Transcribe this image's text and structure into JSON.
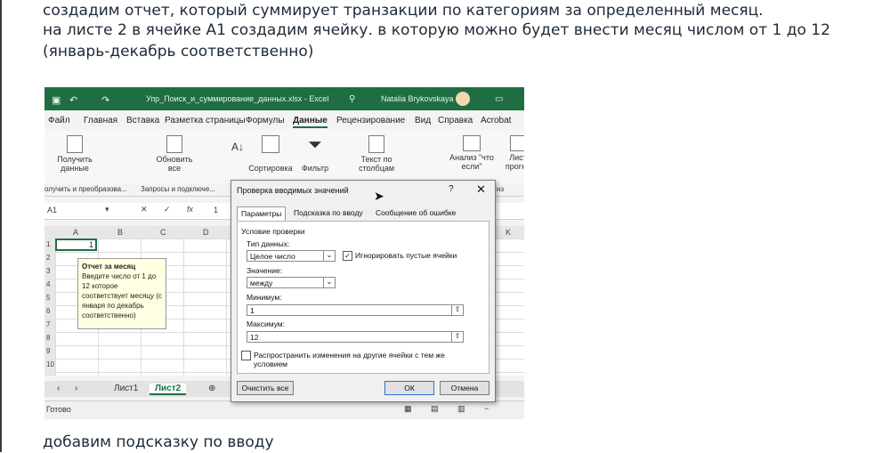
{
  "article": {
    "p1": "создадим отчет, который суммирует транзакции по категориям за определенный месяц.",
    "p2": "на листе 2 в ячейке А1 создадим ячейку. в которую можно будет внести месяц числом от 1 до 12 (январь-декабрь соответственно)",
    "p3": "добавим подсказку по вводу"
  },
  "excel": {
    "window_title": "Упр_Поиск_и_суммирование_данных.xlsx  -  Excel",
    "user": "Natalia Brykovskaya",
    "tabs": [
      "Файл",
      "Главная",
      "Вставка",
      "Разметка страницы",
      "Формулы",
      "Данные",
      "Рецензирование",
      "Вид",
      "Справка",
      "Acrobat"
    ],
    "active_tab": "Данные",
    "ribbon": {
      "refresh_line1": "Получить",
      "refresh_line2": "данные",
      "update_line1": "Обновить",
      "update_line2": "все",
      "sort": "Сортировка",
      "filter": "Фильтр",
      "text_cols_line1": "Текст по",
      "text_cols_line2": "столбцам",
      "whatif_line1": "Анализ \"что",
      "whatif_line2": "если\"",
      "forecast_line1": "Лист",
      "forecast_line2": "прогно"
    },
    "groups": [
      "олучить и преобразова...",
      "Запросы и подключе...",
      "нз"
    ],
    "namebox": "A1",
    "formula_value": "1",
    "columns": [
      "A",
      "B",
      "C",
      "D",
      "K"
    ],
    "rows": [
      "1",
      "2",
      "3",
      "4",
      "5",
      "6",
      "7",
      "8",
      "9",
      "10"
    ],
    "cell_a1": "1",
    "tooltip": {
      "title": "Отчет за месяц",
      "body": "Введите число  от 1 до 12  которое соответствует месяцу (с января по декабрь соответственно)"
    },
    "sheets": [
      "Лист1",
      "Лист2"
    ],
    "active_sheet": "Лист2",
    "status": "Готово"
  },
  "dialog": {
    "title": "Проверка вводимых значений",
    "help": "?",
    "close": "✕",
    "tabs": [
      "Параметры",
      "Подсказка по вводу",
      "Сообщение об ошибке"
    ],
    "section": "Условие проверки",
    "data_type_label": "Тип данных:",
    "data_type_value": "Целое число",
    "ignore_blank": "Игнорировать пустые ячейки",
    "value_label": "Значение:",
    "value_value": "между",
    "min_label": "Минимум:",
    "min_value": "1",
    "max_label": "Максимум:",
    "max_value": "12",
    "apply_all": "Распространить изменения на другие ячейки с тем же условием",
    "clear_all": "Очистить все",
    "ok": "ОК",
    "cancel": "Отмена"
  }
}
